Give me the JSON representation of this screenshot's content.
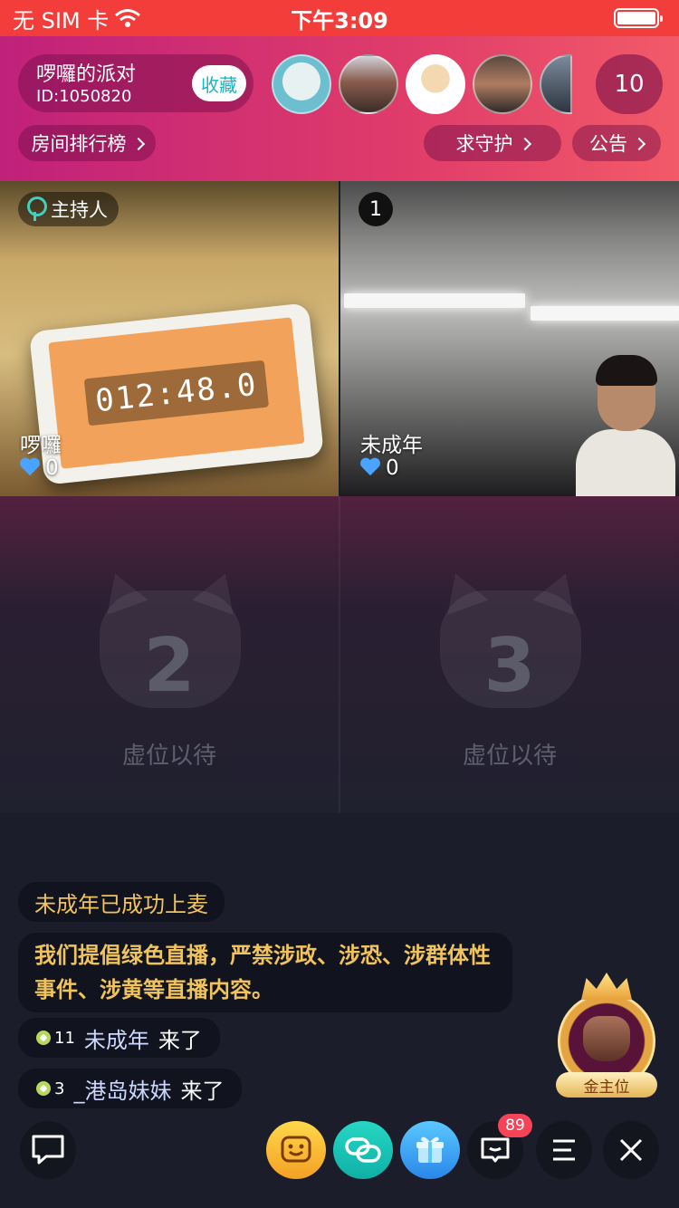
{
  "status_bar": {
    "carrier": "无 SIM 卡",
    "time": "下午3:09"
  },
  "room": {
    "name": "啰囉的派对",
    "id": "ID:1050820",
    "favorite_label": "收藏",
    "online_count": "10"
  },
  "header_links": {
    "rank": "房间排行榜",
    "guard": "求守护",
    "notice": "公告"
  },
  "seats": {
    "host_tag": "主持人",
    "host": {
      "name": "啰囉",
      "likes": "0",
      "timer_display": "012:48.0"
    },
    "seat1": {
      "number": "1",
      "name": "未成年",
      "likes": "0"
    },
    "seat2": {
      "number": "2",
      "label": "虚位以待"
    },
    "seat3": {
      "number": "3",
      "label": "虚位以待"
    }
  },
  "chat": {
    "system_msg": "未成年已成功上麦",
    "notice": "我们提倡绿色直播，严禁涉政、涉恐、涉群体性事件、涉黄等直播内容。",
    "entries": [
      {
        "level": "11",
        "name": "未成年",
        "verb": "来了"
      },
      {
        "level": "3",
        "name": "_港岛妹妹",
        "verb": "来了"
      }
    ]
  },
  "gold_seat": {
    "label": "金主位"
  },
  "bottom_bar": {
    "message_badge": "89"
  },
  "colors": {
    "status_bar": "#f23d3a",
    "header_gradient_start": "#c0217a",
    "accent_gold": "#f1c35c",
    "favorite_text": "#18b3c6"
  }
}
